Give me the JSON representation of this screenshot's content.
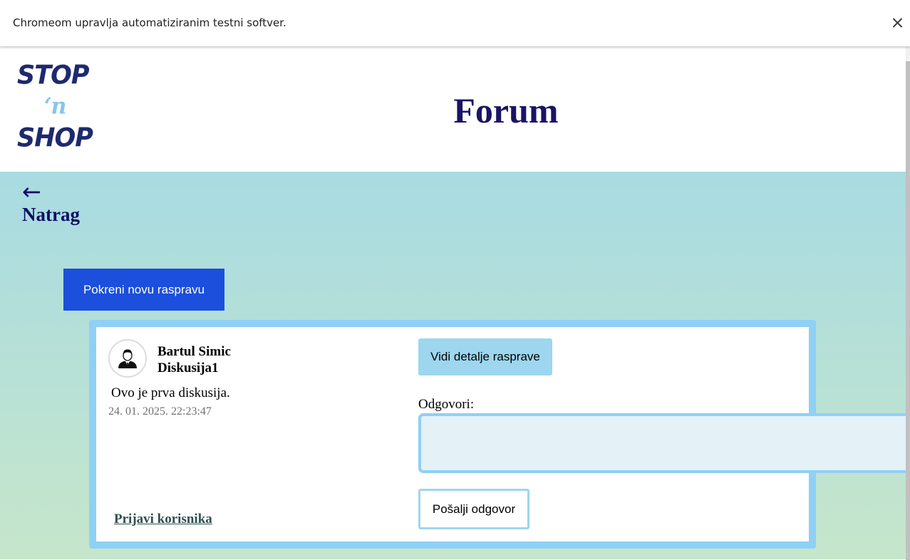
{
  "infobar": {
    "message": "Chromeom upravlja automatiziranim testni softver.",
    "close_icon": "close-icon"
  },
  "logo": {
    "line1": "STOP",
    "line2": "‘n",
    "line3": "SHOP"
  },
  "header": {
    "title": "Forum"
  },
  "back": {
    "arrow": "←",
    "label": "Natrag"
  },
  "actions": {
    "new_discussion": "Pokreni novu raspravu"
  },
  "discussions": [
    {
      "author": "Bartul Simic",
      "title": "Diskusija1",
      "body": "Ovo je prva diskusija.",
      "date": "24. 01. 2025. 22:23:47",
      "details_button": "Vidi detalje rasprave",
      "reply_label": "Odgovori:",
      "reply_value": "",
      "send_button": "Pošalji odgovor",
      "report_link": "Prijavi korisnika"
    }
  ],
  "colors": {
    "primary_button": "#1b4fdc",
    "card_border": "#8fd0f5",
    "title": "#1a1464",
    "logo_dark": "#1e2a6e",
    "logo_light": "#85c6ee"
  }
}
